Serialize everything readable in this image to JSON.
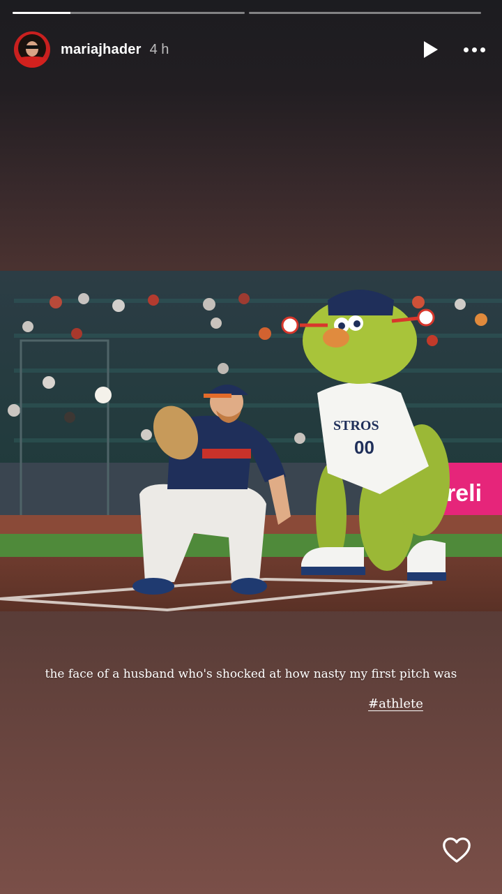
{
  "story": {
    "progress": [
      {
        "fraction": 0.25
      },
      {
        "fraction": 0
      }
    ],
    "username": "mariajhader",
    "timestamp": "4 h",
    "photo": {
      "jersey_text": "STROS",
      "jersey_number": "00",
      "banner_text": "reli"
    },
    "caption": "the face of a husband who's shocked at how nasty my first pitch was",
    "hashtag": "#athlete"
  },
  "icons": {
    "play": "play-icon",
    "more": "more-horizontal-icon",
    "like": "heart-outline-icon"
  },
  "colors": {
    "mascot_green": "#9bb836",
    "astros_navy": "#1f2f5a",
    "banner_pink": "#e6257a"
  }
}
